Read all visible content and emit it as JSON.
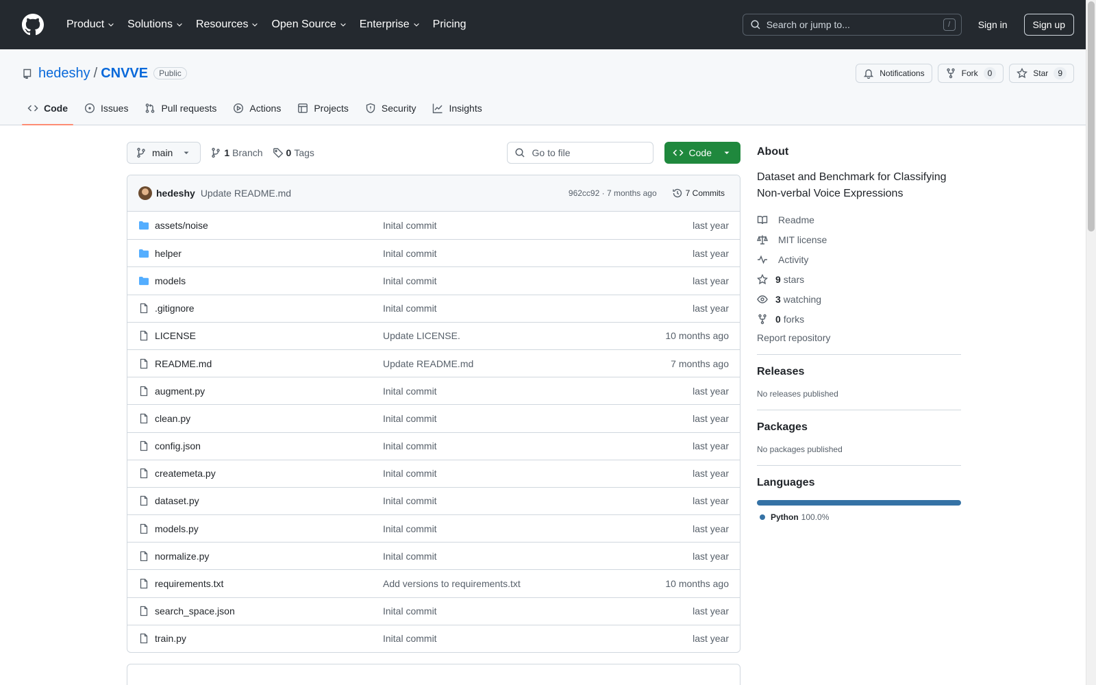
{
  "header": {
    "nav": [
      "Product",
      "Solutions",
      "Resources",
      "Open Source",
      "Enterprise",
      "Pricing"
    ],
    "search_placeholder": "Search or jump to...",
    "search_shortcut": "/",
    "sign_in": "Sign in",
    "sign_up": "Sign up"
  },
  "repo": {
    "owner": "hedeshy",
    "separator": "/",
    "name": "CNVVE",
    "visibility": "Public",
    "notifications_label": "Notifications",
    "fork_label": "Fork",
    "fork_count": "0",
    "star_label": "Star",
    "star_count": "9"
  },
  "tabs": [
    {
      "label": "Code",
      "icon": "code-icon",
      "active": true
    },
    {
      "label": "Issues",
      "icon": "issue-icon"
    },
    {
      "label": "Pull requests",
      "icon": "pull-request-icon"
    },
    {
      "label": "Actions",
      "icon": "play-icon"
    },
    {
      "label": "Projects",
      "icon": "table-icon"
    },
    {
      "label": "Security",
      "icon": "shield-icon"
    },
    {
      "label": "Insights",
      "icon": "graph-icon"
    }
  ],
  "filebar": {
    "branch": "main",
    "branch_count": "1",
    "branch_label": "Branch",
    "tag_count": "0",
    "tag_label": "Tags",
    "goto_placeholder": "Go to file",
    "code_button": "Code"
  },
  "commit": {
    "author": "hedeshy",
    "message": "Update README.md",
    "meta": "962cc92 · 7 months ago",
    "commits": "7 Commits"
  },
  "files": [
    {
      "name": "assets/noise",
      "type": "folder",
      "message": "Inital commit",
      "time": "last year"
    },
    {
      "name": "helper",
      "type": "folder",
      "message": "Inital commit",
      "time": "last year"
    },
    {
      "name": "models",
      "type": "folder",
      "message": "Inital commit",
      "time": "last year"
    },
    {
      "name": ".gitignore",
      "type": "file",
      "message": "Inital commit",
      "time": "last year"
    },
    {
      "name": "LICENSE",
      "type": "file",
      "message": "Update LICENSE.",
      "time": "10 months ago"
    },
    {
      "name": "README.md",
      "type": "file",
      "message": "Update README.md",
      "time": "7 months ago"
    },
    {
      "name": "augment.py",
      "type": "file",
      "message": "Inital commit",
      "time": "last year"
    },
    {
      "name": "clean.py",
      "type": "file",
      "message": "Inital commit",
      "time": "last year"
    },
    {
      "name": "config.json",
      "type": "file",
      "message": "Inital commit",
      "time": "last year"
    },
    {
      "name": "createmeta.py",
      "type": "file",
      "message": "Inital commit",
      "time": "last year"
    },
    {
      "name": "dataset.py",
      "type": "file",
      "message": "Inital commit",
      "time": "last year"
    },
    {
      "name": "models.py",
      "type": "file",
      "message": "Inital commit",
      "time": "last year"
    },
    {
      "name": "normalize.py",
      "type": "file",
      "message": "Inital commit",
      "time": "last year"
    },
    {
      "name": "requirements.txt",
      "type": "file",
      "message": "Add versions to requirements.txt",
      "time": "10 months ago"
    },
    {
      "name": "search_space.json",
      "type": "file",
      "message": "Inital commit",
      "time": "last year"
    },
    {
      "name": "train.py",
      "type": "file",
      "message": "Inital commit",
      "time": "last year"
    }
  ],
  "about": {
    "heading": "About",
    "description": "Dataset and Benchmark for Classifying Non-verbal Voice Expressions",
    "links": [
      {
        "icon": "book-icon",
        "count": "",
        "label": "Readme"
      },
      {
        "icon": "law-icon",
        "count": "",
        "label": "MIT license"
      },
      {
        "icon": "pulse-icon",
        "count": "",
        "label": "Activity"
      },
      {
        "icon": "star-icon",
        "count": "9",
        "label": "stars"
      },
      {
        "icon": "eye-icon",
        "count": "3",
        "label": "watching"
      },
      {
        "icon": "fork-icon",
        "count": "0",
        "label": "forks"
      }
    ],
    "report": "Report repository"
  },
  "releases": {
    "heading": "Releases",
    "text": "No releases published"
  },
  "packages": {
    "heading": "Packages",
    "text": "No packages published"
  },
  "languages": {
    "heading": "Languages",
    "items": [
      {
        "name": "Python",
        "percent": "100.0%",
        "color": "#3572A5"
      }
    ]
  },
  "colors": {
    "accent": "#0969da",
    "code_button": "#1f883d",
    "header_bg": "#24292f",
    "folder": "#54aeff",
    "tab_underline": "#fd8c73"
  }
}
